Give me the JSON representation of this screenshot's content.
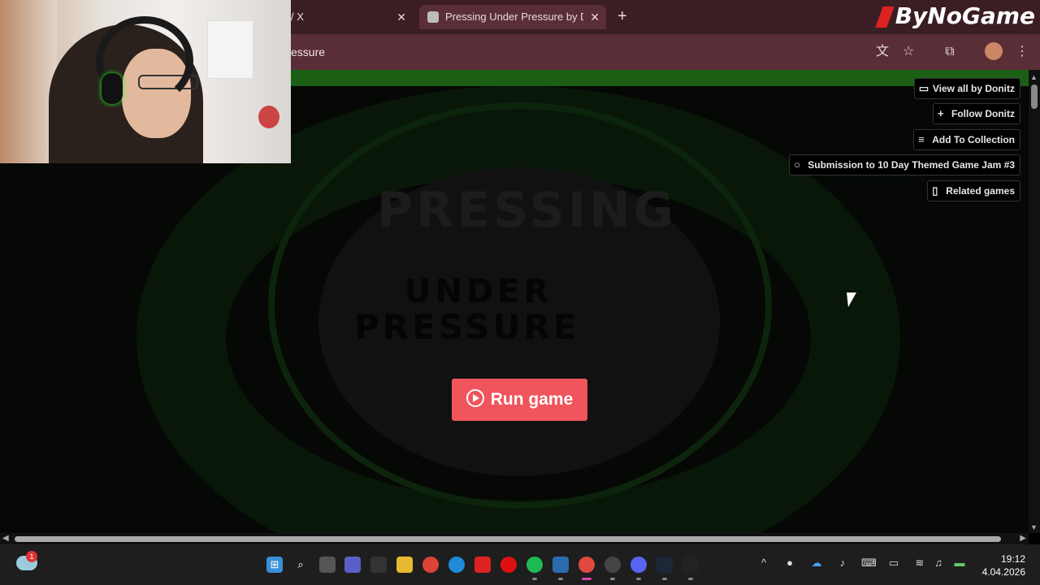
{
  "browser": {
    "tabs": [
      {
        "title": "/ X",
        "close": "✕"
      },
      {
        "title": "Pressing Under Pressure by Donitz",
        "close": "✕"
      }
    ],
    "new_tab": "+",
    "address": "essure",
    "toolbar_icons": [
      "translate-icon",
      "star-icon",
      "extensions-icon",
      "profile-avatar",
      "menu-icon"
    ]
  },
  "brand": {
    "text": "ByNoGame"
  },
  "page": {
    "side_buttons": [
      {
        "label": "View all by Donitz",
        "icon": "view-all-icon"
      },
      {
        "label": "Follow Donitz",
        "icon": "follow-icon"
      },
      {
        "label": "Add To Collection",
        "icon": "collection-icon"
      },
      {
        "label": "Submission to 10 Day Themed Game Jam #3",
        "icon": "award-icon"
      },
      {
        "label": "Related games",
        "icon": "map-icon"
      }
    ],
    "logo": {
      "line1": "PRESSING",
      "line2": "UNDER",
      "line3": "PRESSURE"
    },
    "run_button": "Run game"
  },
  "taskbar": {
    "weather_badge": "1",
    "clock": {
      "time": "19:12",
      "date": "4.04.2026"
    }
  },
  "colors": {
    "chrome_bg": "#3a1e24",
    "toolbar_bg": "#5a2e36",
    "green_bar": "#1b5e14",
    "run_button": "#f0545c"
  }
}
